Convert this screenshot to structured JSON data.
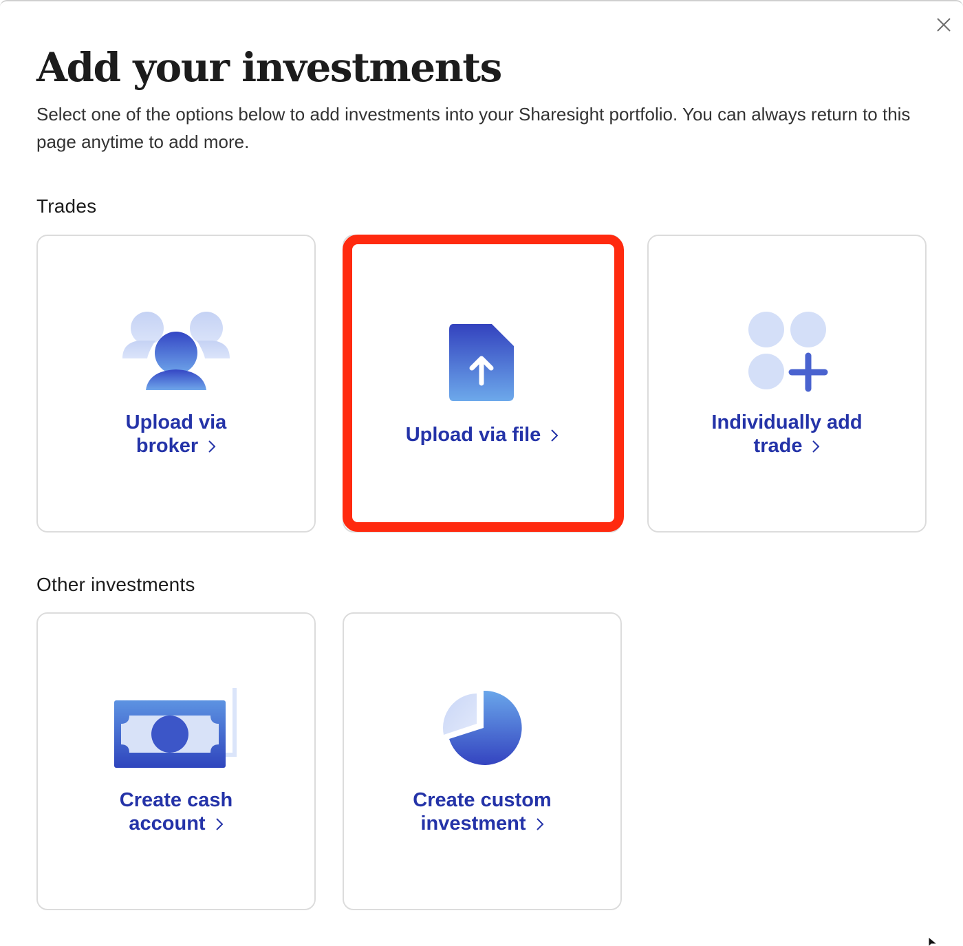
{
  "modal": {
    "title": "Add your investments",
    "subtitle": "Select one of the options below to add investments into your Sharesight portfolio. You can always return to this page anytime to add more.",
    "close_icon": "close-icon"
  },
  "sections": {
    "trades": {
      "label": "Trades",
      "cards": [
        {
          "line1": "Upload via",
          "line2": "broker",
          "icon": "people-icon"
        },
        {
          "line1": "Upload via file",
          "icon": "upload-file-icon",
          "highlighted": true
        },
        {
          "line1": "Individually add",
          "line2": "trade",
          "icon": "add-grid-icon"
        }
      ]
    },
    "other": {
      "label": "Other investments",
      "cards": [
        {
          "line1": "Create cash",
          "line2": "account",
          "icon": "banknote-icon"
        },
        {
          "line1": "Create custom",
          "line2": "investment",
          "icon": "pie-chart-icon"
        }
      ]
    }
  },
  "colors": {
    "link": "#2433a8",
    "highlight": "#ff2a0f",
    "icon_dark": "#3d52c8",
    "icon_light": "#d6dff7"
  }
}
